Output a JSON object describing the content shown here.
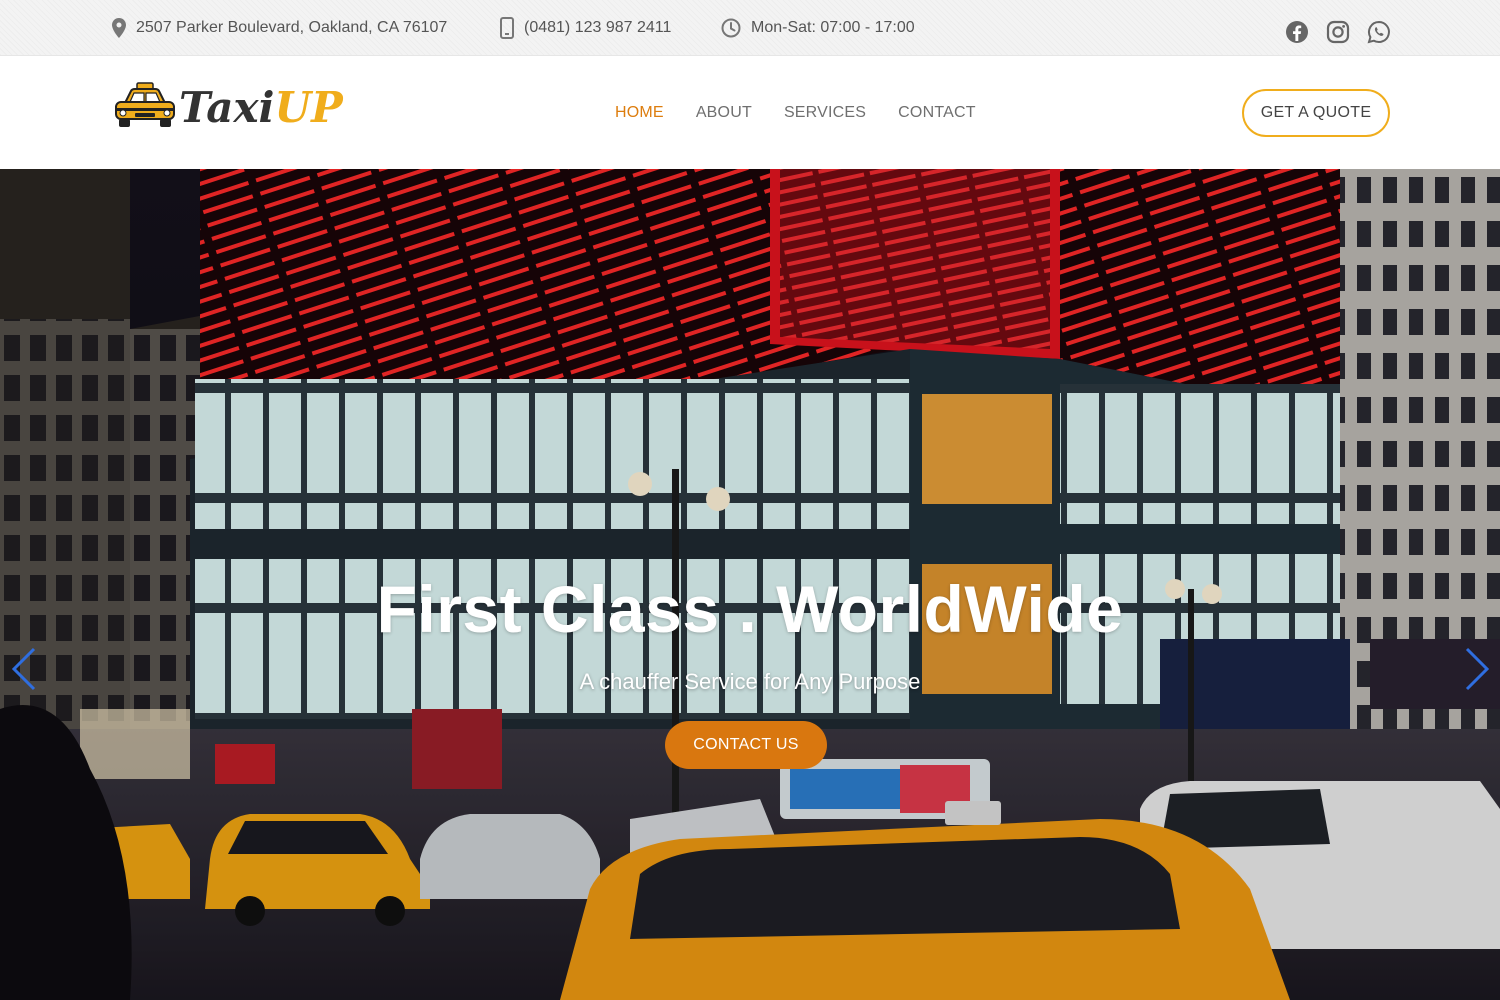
{
  "topbar": {
    "address": "2507 Parker Boulevard, Oakland, CA 76107",
    "phone": "(0481) 123 987 2411",
    "hours": "Mon-Sat: 07:00 - 17:00",
    "icons": [
      "location-pin-icon",
      "mobile-phone-icon",
      "clock-icon"
    ],
    "social": [
      "facebook-icon",
      "instagram-icon",
      "whatsapp-icon"
    ]
  },
  "brand": {
    "logo_part1": "Taxi",
    "logo_part2": "UP",
    "logo_icon": "taxi-car-icon",
    "accent_color": "#f0ad1c",
    "active_color": "#dd7d0e"
  },
  "nav": {
    "items": [
      {
        "label": "HOME",
        "active": true
      },
      {
        "label": "ABOUT",
        "active": false
      },
      {
        "label": "SERVICES",
        "active": false
      },
      {
        "label": "CONTACT",
        "active": false
      }
    ],
    "quote_button": "GET A QUOTE"
  },
  "hero": {
    "title": "First Class . WorldWide",
    "subtitle": "A chauffer Service for Any Purpose",
    "cta_label": "CONTACT US",
    "cta_color": "#d9770f",
    "prev_icon": "chevron-left-icon",
    "next_icon": "chevron-right-icon"
  }
}
